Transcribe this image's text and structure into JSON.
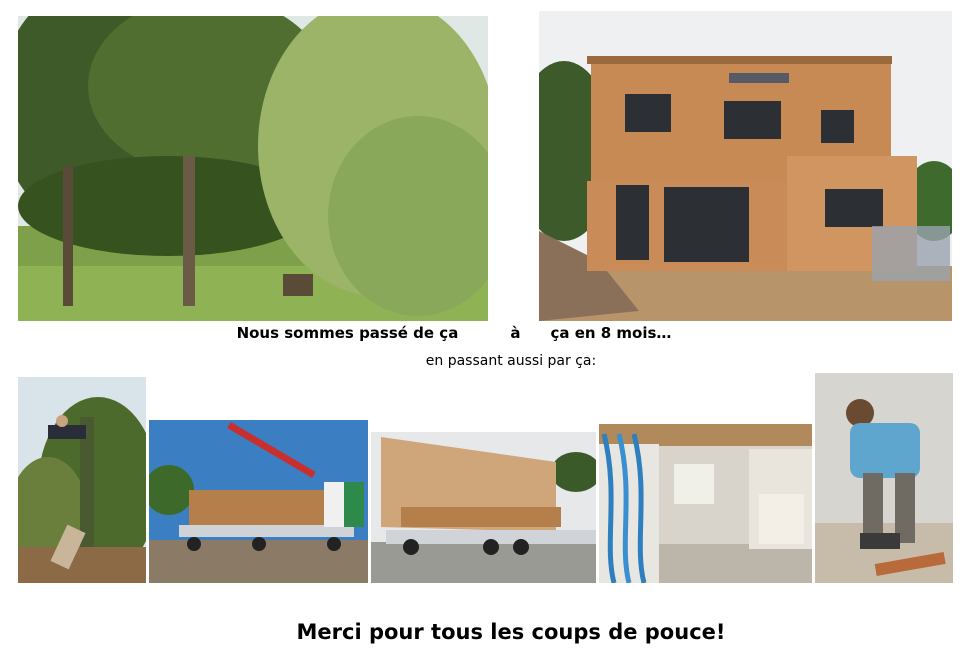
{
  "captions": {
    "line1_part1": "Nous sommes passé de ça",
    "line1_part2": "à",
    "line1_part3": "ça en 8 mois…",
    "line2": "en passant aussi par ça:",
    "thanks": "Merci pour tous les coups de pouce!"
  }
}
